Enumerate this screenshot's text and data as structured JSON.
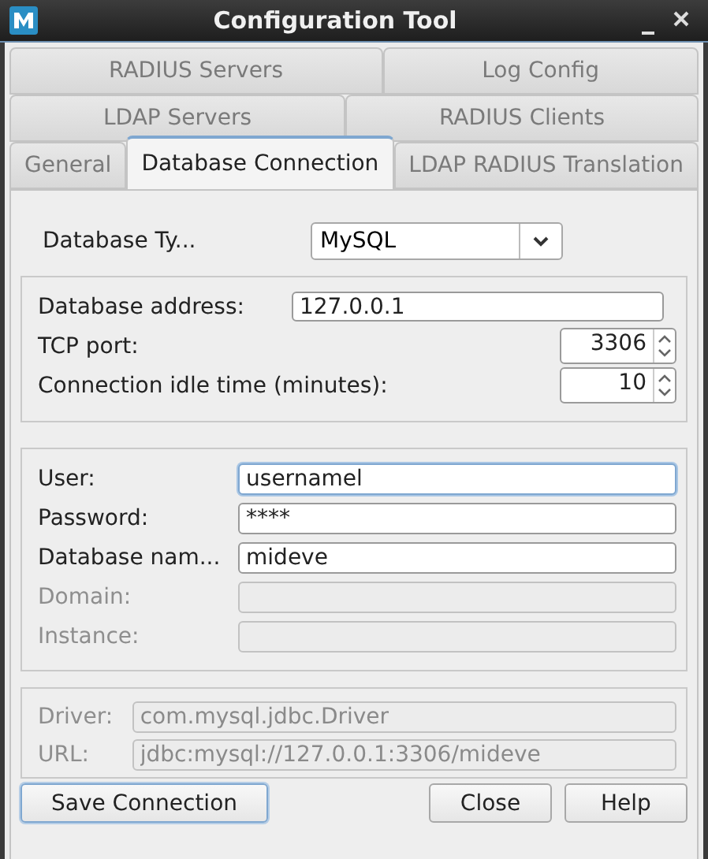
{
  "window": {
    "title": "Configuration Tool"
  },
  "tab_rows": [
    [
      {
        "label": "RADIUS Servers",
        "selected": false
      },
      {
        "label": "Log Config",
        "selected": false
      }
    ],
    [
      {
        "label": "LDAP Servers",
        "selected": false
      },
      {
        "label": "RADIUS Clients",
        "selected": false
      }
    ],
    [
      {
        "label": "General",
        "selected": false
      },
      {
        "label": "Database Connection",
        "selected": true
      },
      {
        "label": "LDAP RADIUS Translation",
        "selected": false
      }
    ]
  ],
  "database_type": {
    "label": "Database Ty...",
    "value": "MySQL"
  },
  "connection": [
    {
      "kind": "text",
      "label": "Database address:",
      "value": "127.0.0.1"
    },
    {
      "kind": "spinner",
      "label": "TCP port:",
      "value": "3306"
    },
    {
      "kind": "spinner",
      "label": "Connection idle time (minutes):",
      "value": "10"
    }
  ],
  "credentials": [
    {
      "label": "User:",
      "value": "usernamel",
      "focused": true,
      "disabled": false
    },
    {
      "label": "Password:",
      "value": "****",
      "focused": false,
      "disabled": false
    },
    {
      "label": "Database nam...",
      "value": "mideve",
      "focused": false,
      "disabled": false
    },
    {
      "label": "Domain:",
      "focused": false,
      "disabled": true
    },
    {
      "label": "Instance:",
      "focused": false,
      "disabled": true
    }
  ],
  "driver": [
    {
      "label": "Driver:",
      "value": "com.mysql.jdbc.Driver",
      "disabled": true
    },
    {
      "label": "URL:",
      "value": "jdbc:mysql://127.0.0.1:3306/mideve",
      "disabled": true
    }
  ],
  "buttons": [
    {
      "label": "Save Connection",
      "focused": true
    },
    {
      "label": "Close",
      "focused": false
    },
    {
      "label": "Help",
      "focused": false
    }
  ]
}
